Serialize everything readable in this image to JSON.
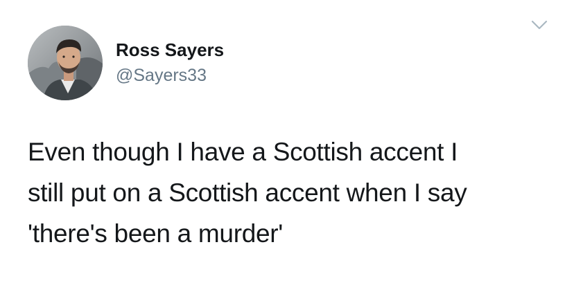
{
  "author": {
    "display_name": "Ross Sayers",
    "handle": "@Sayers33"
  },
  "menu": {
    "icon": "chevron-down-icon"
  },
  "tweet": {
    "lines": [
      "Even though I have a Scottish accent I",
      "still put on a Scottish accent when I say",
      "'there's been a murder'"
    ]
  },
  "colors": {
    "background": "#ffffff",
    "text_primary": "#14171a",
    "text_secondary": "#657786",
    "chevron": "#aab8c2"
  }
}
